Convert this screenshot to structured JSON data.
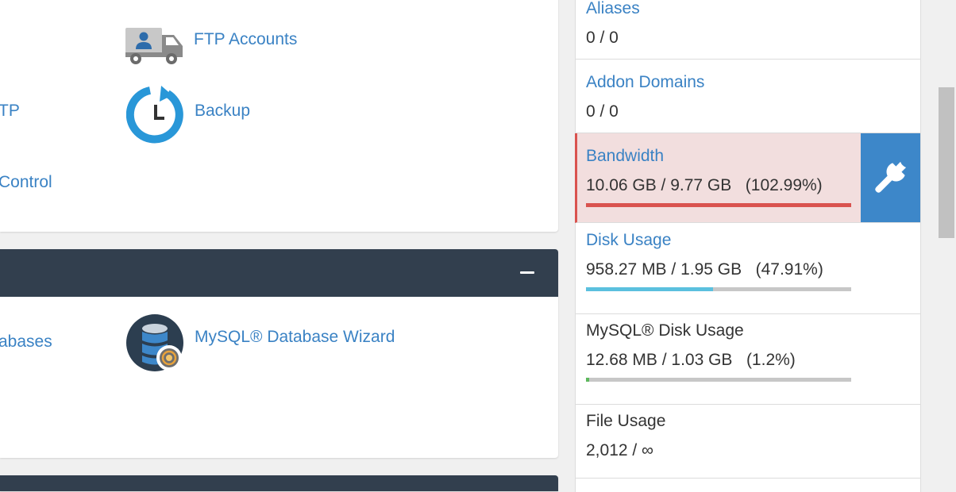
{
  "files_section": {
    "left_items": [
      {
        "label": "TP"
      },
      {
        "label": "Control"
      }
    ],
    "ftp_accounts": {
      "label": "FTP Accounts",
      "icon": "ftp-truck-icon"
    },
    "backup": {
      "label": "Backup",
      "icon": "backup-clock-icon"
    }
  },
  "databases_section": {
    "left_item": {
      "label": "abases"
    },
    "mysql_wizard": {
      "label": "MySQL® Database Wizard",
      "icon": "database-wizard-icon"
    },
    "collapse_icon": "minus-icon"
  },
  "stats": {
    "aliases": {
      "title": "Aliases",
      "value": "0 / 0"
    },
    "addon_domains": {
      "title": "Addon Domains",
      "value": "0 / 0"
    },
    "bandwidth": {
      "title": "Bandwidth",
      "value": "10.06 GB / 9.77 GB   (102.99%)",
      "percent": 102.99,
      "bar_color": "#d9534f",
      "action_icon": "wrench-icon"
    },
    "disk_usage": {
      "title": "Disk Usage",
      "value": "958.27 MB / 1.95 GB   (47.91%)",
      "percent": 47.91,
      "bar_color": "#5bc0de"
    },
    "mysql_disk_usage": {
      "title": "MySQL® Disk Usage",
      "value": "12.68 MB / 1.03 GB   (1.2%)",
      "percent": 1.2,
      "bar_color": "#5cb85c"
    },
    "file_usage": {
      "title": "File Usage",
      "value": "2,012 / ∞"
    }
  },
  "colors": {
    "link": "#3a82c4",
    "panel_header": "#323f4e",
    "danger_bg": "#f2dede",
    "danger": "#d9534f",
    "tool_button": "#3d87c9"
  }
}
